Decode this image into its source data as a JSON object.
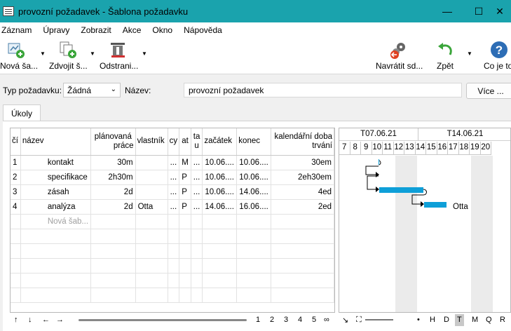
{
  "window": {
    "title": "provozní požadavek - Šablona požadavku",
    "minimize": "—",
    "maximize": "☐",
    "close": "✕"
  },
  "menu": [
    "Záznam",
    "Úpravy",
    "Zobrazit",
    "Akce",
    "Okno",
    "Nápověda"
  ],
  "toolbar": {
    "new": "Nová ša...",
    "duplicate": "Zdvojit š...",
    "remove": "Odstrani...",
    "revert": "Navrátit sd...",
    "undo": "Zpět",
    "help": "Co je to..."
  },
  "fields": {
    "type_label": "Typ požadavku:",
    "type_value": "Žádná",
    "name_label": "Název:",
    "name_value": "provozní požadavek",
    "more_button": "Více ..."
  },
  "tabs": {
    "tasks": "Úkoly"
  },
  "grid": {
    "headers": {
      "num": "čí",
      "name": "název",
      "planned_1": "plánovaná",
      "planned_2": "práce",
      "owner": "vlastník",
      "cy": "cy",
      "at": "at",
      "ta_1": "ta",
      "ta_2": "u",
      "start": "začátek",
      "end": "konec",
      "calendar_1": "kalendářní doba",
      "calendar_2": "trvání"
    },
    "rows": [
      {
        "num": "1",
        "name": "kontakt",
        "planned": "30m",
        "owner": "",
        "cy": "...",
        "at": "M",
        "ta": "...",
        "start": "10.06....",
        "end": "10.06....",
        "duration": "30em"
      },
      {
        "num": "2",
        "name": "specifikace",
        "planned": "2h30m",
        "owner": "",
        "cy": "...",
        "at": "P",
        "ta": "...",
        "start": "10.06....",
        "end": "10.06....",
        "duration": "2eh30em"
      },
      {
        "num": "3",
        "name": "zásah",
        "planned": "2d",
        "owner": "",
        "cy": "...",
        "at": "P",
        "ta": "...",
        "start": "10.06....",
        "end": "14.06....",
        "duration": "4ed"
      },
      {
        "num": "4",
        "name": "analýza",
        "planned": "2d",
        "owner": "Otta",
        "cy": "...",
        "at": "P",
        "ta": "...",
        "start": "14.06....",
        "end": "16.06....",
        "duration": "2ed"
      }
    ],
    "new_row_placeholder": "Nová šab..."
  },
  "nav": {
    "up": "↑",
    "down": "↓",
    "left": "←",
    "right": "→",
    "pages": [
      "1",
      "2",
      "3",
      "4",
      "5",
      "∞"
    ]
  },
  "gantt": {
    "weeks": [
      "T07.06.21",
      "T14.06.21"
    ],
    "days": [
      "7",
      "8",
      "9",
      "10",
      "11",
      "12",
      "13",
      "14",
      "15",
      "16",
      "17",
      "18",
      "19",
      "20"
    ],
    "bar_color": "#0e9fd8",
    "owner_label": "Otta"
  },
  "zoom": {
    "fit": "↘",
    "expand": "⛶",
    "dot": "•",
    "levels": [
      "H",
      "D",
      "T",
      "M",
      "Q",
      "R"
    ],
    "active": "T"
  }
}
